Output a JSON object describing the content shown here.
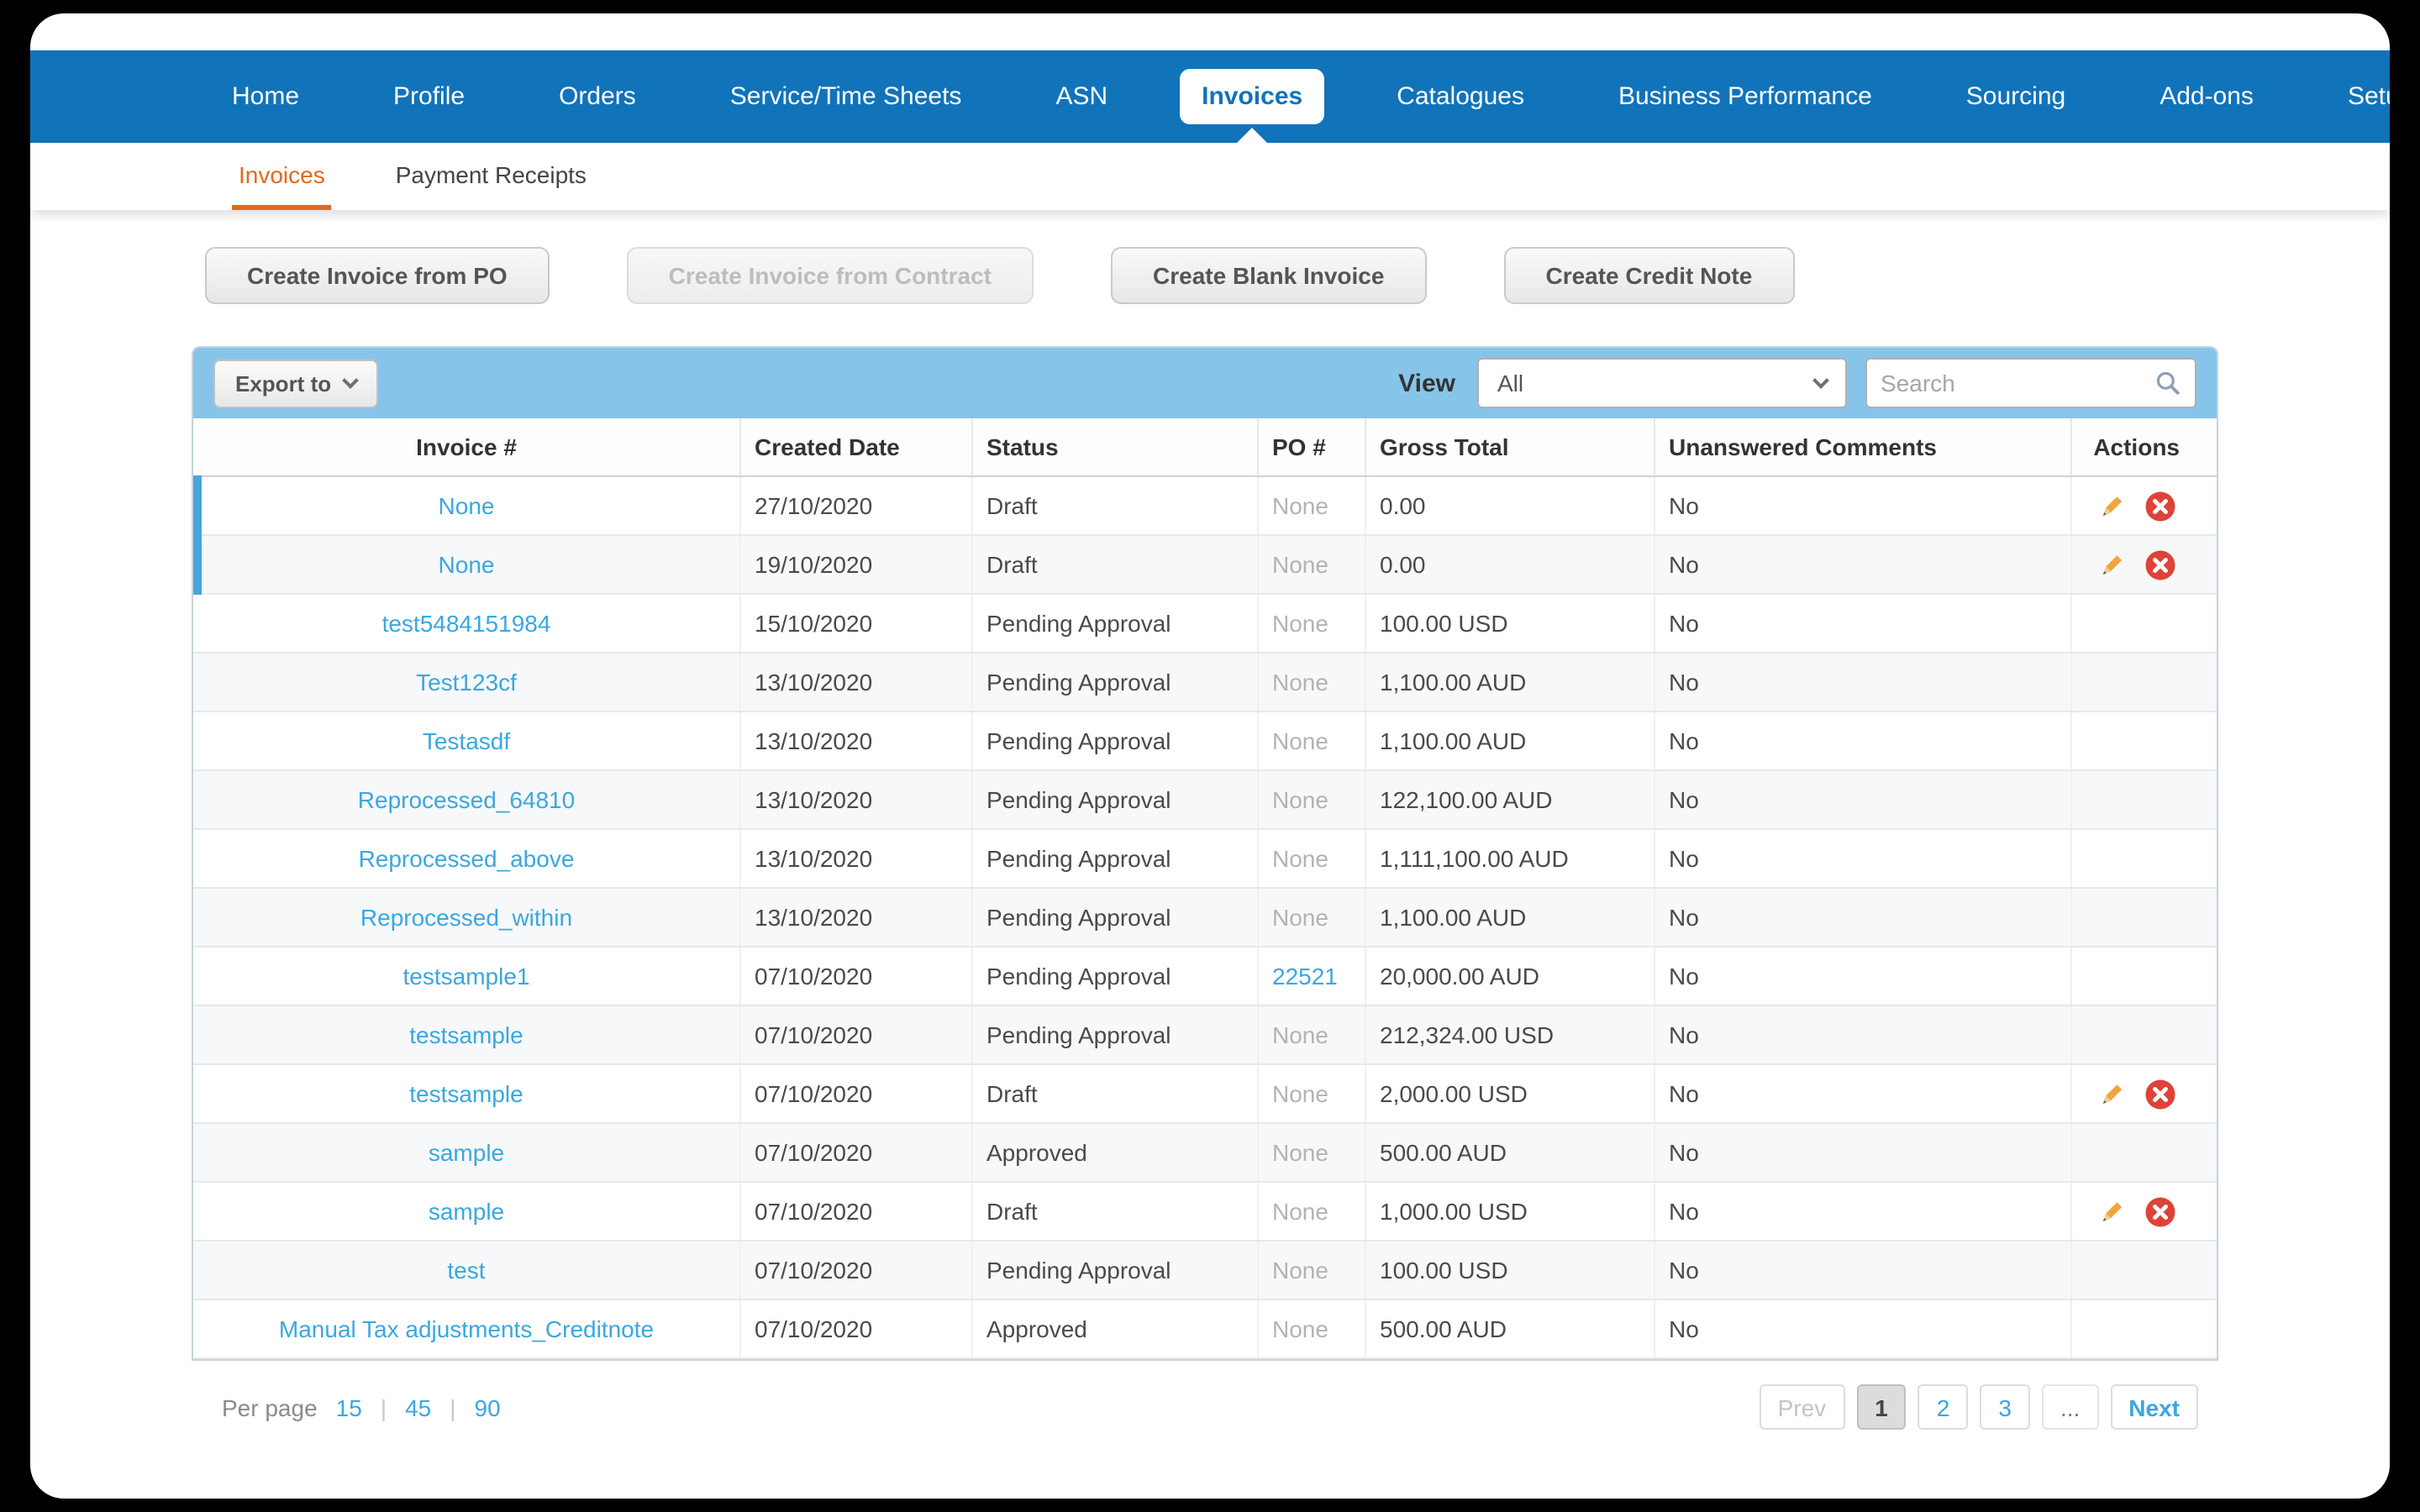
{
  "nav": {
    "items": [
      {
        "label": "Home"
      },
      {
        "label": "Profile"
      },
      {
        "label": "Orders"
      },
      {
        "label": "Service/Time Sheets"
      },
      {
        "label": "ASN"
      },
      {
        "label": "Invoices"
      },
      {
        "label": "Catalogues"
      },
      {
        "label": "Business Performance"
      },
      {
        "label": "Sourcing"
      },
      {
        "label": "Add-ons"
      },
      {
        "label": "Setup"
      }
    ],
    "active": "Invoices"
  },
  "subnav": {
    "items": [
      {
        "label": "Invoices",
        "active": true
      },
      {
        "label": "Payment Receipts",
        "active": false
      }
    ]
  },
  "action_buttons": [
    {
      "label": "Create Invoice from PO",
      "enabled": true
    },
    {
      "label": "Create Invoice from Contract",
      "enabled": false
    },
    {
      "label": "Create Blank Invoice",
      "enabled": true
    },
    {
      "label": "Create Credit Note",
      "enabled": true
    }
  ],
  "toolbar": {
    "export_label": "Export to",
    "view_label": "View",
    "view_value": "All",
    "search_placeholder": "Search"
  },
  "table": {
    "columns": [
      "Invoice #",
      "Created Date",
      "Status",
      "PO #",
      "Gross Total",
      "Unanswered Comments",
      "Actions"
    ],
    "rows": [
      {
        "invoice": "None",
        "created": "27/10/2020",
        "status": "Draft",
        "po": "None",
        "po_link": false,
        "gross": "0.00",
        "comments": "No",
        "actions": true,
        "accent": true
      },
      {
        "invoice": "None",
        "created": "19/10/2020",
        "status": "Draft",
        "po": "None",
        "po_link": false,
        "gross": "0.00",
        "comments": "No",
        "actions": true,
        "accent": true
      },
      {
        "invoice": "test5484151984",
        "created": "15/10/2020",
        "status": "Pending Approval",
        "po": "None",
        "po_link": false,
        "gross": "100.00 USD",
        "comments": "No",
        "actions": false,
        "accent": false
      },
      {
        "invoice": "Test123cf",
        "created": "13/10/2020",
        "status": "Pending Approval",
        "po": "None",
        "po_link": false,
        "gross": "1,100.00 AUD",
        "comments": "No",
        "actions": false,
        "accent": false
      },
      {
        "invoice": "Testasdf",
        "created": "13/10/2020",
        "status": "Pending Approval",
        "po": "None",
        "po_link": false,
        "gross": "1,100.00 AUD",
        "comments": "No",
        "actions": false,
        "accent": false
      },
      {
        "invoice": "Reprocessed_64810",
        "created": "13/10/2020",
        "status": "Pending Approval",
        "po": "None",
        "po_link": false,
        "gross": "122,100.00 AUD",
        "comments": "No",
        "actions": false,
        "accent": false
      },
      {
        "invoice": "Reprocessed_above",
        "created": "13/10/2020",
        "status": "Pending Approval",
        "po": "None",
        "po_link": false,
        "gross": "1,111,100.00 AUD",
        "comments": "No",
        "actions": false,
        "accent": false
      },
      {
        "invoice": "Reprocessed_within",
        "created": "13/10/2020",
        "status": "Pending Approval",
        "po": "None",
        "po_link": false,
        "gross": "1,100.00 AUD",
        "comments": "No",
        "actions": false,
        "accent": false
      },
      {
        "invoice": "testsample1",
        "created": "07/10/2020",
        "status": "Pending Approval",
        "po": "22521",
        "po_link": true,
        "gross": "20,000.00 AUD",
        "comments": "No",
        "actions": false,
        "accent": false
      },
      {
        "invoice": "testsample",
        "created": "07/10/2020",
        "status": "Pending Approval",
        "po": "None",
        "po_link": false,
        "gross": "212,324.00 USD",
        "comments": "No",
        "actions": false,
        "accent": false
      },
      {
        "invoice": "testsample",
        "created": "07/10/2020",
        "status": "Draft",
        "po": "None",
        "po_link": false,
        "gross": "2,000.00 USD",
        "comments": "No",
        "actions": true,
        "accent": false
      },
      {
        "invoice": "sample",
        "created": "07/10/2020",
        "status": "Approved",
        "po": "None",
        "po_link": false,
        "gross": "500.00 AUD",
        "comments": "No",
        "actions": false,
        "accent": false
      },
      {
        "invoice": "sample",
        "created": "07/10/2020",
        "status": "Draft",
        "po": "None",
        "po_link": false,
        "gross": "1,000.00 USD",
        "comments": "No",
        "actions": true,
        "accent": false
      },
      {
        "invoice": "test",
        "created": "07/10/2020",
        "status": "Pending Approval",
        "po": "None",
        "po_link": false,
        "gross": "100.00 USD",
        "comments": "No",
        "actions": false,
        "accent": false
      },
      {
        "invoice": "Manual Tax adjustments_Creditnote",
        "created": "07/10/2020",
        "status": "Approved",
        "po": "None",
        "po_link": false,
        "gross": "500.00 AUD",
        "comments": "No",
        "actions": false,
        "accent": false
      }
    ]
  },
  "footer": {
    "per_page_label": "Per page",
    "per_page_options": [
      "15",
      "45",
      "90"
    ],
    "pagination": {
      "prev": "Prev",
      "pages": [
        "1",
        "2",
        "3"
      ],
      "active_page": "1",
      "ellipsis": "...",
      "next": "Next"
    }
  },
  "colors": {
    "nav_blue": "#1173b9",
    "toolbar_blue": "#87c4e9",
    "link_blue": "#3aa7e0",
    "active_tab_orange": "#e2691d",
    "row_accent_blue": "#49a5dc",
    "delete_red": "#dd4338",
    "pencil_orange": "#f2a53d"
  }
}
